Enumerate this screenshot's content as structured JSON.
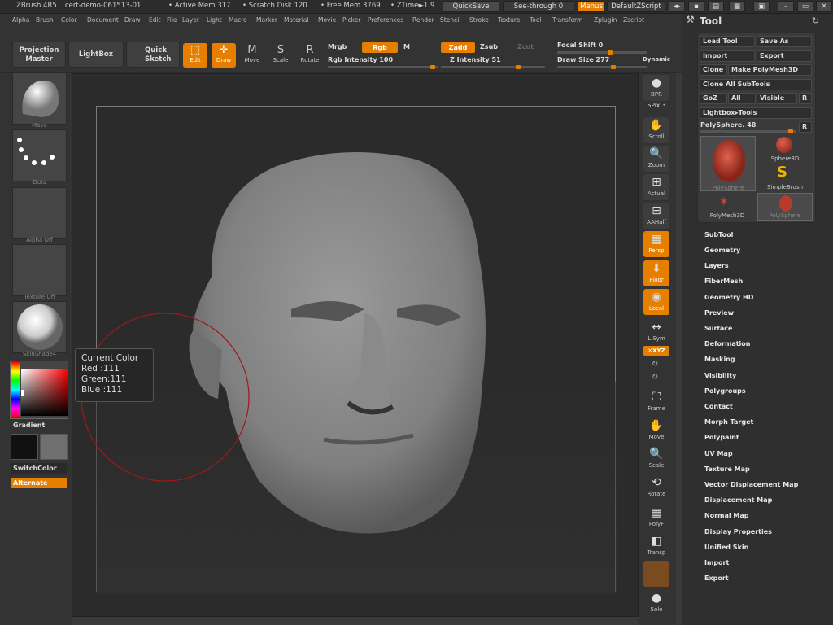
{
  "titlebar": {
    "app": "ZBrush 4R5",
    "doc": "cert-demo-061513-01",
    "active_mem": "• Active Mem 317",
    "scratch": "• Scratch Disk 120",
    "free_mem": "• Free Mem 3769",
    "ztime": "• ZTime►1.9",
    "quicksave": "QuickSave",
    "seethrough": "See-through  0",
    "menus": "Menus",
    "default_script": "DefaultZScript"
  },
  "menubar": {
    "items": [
      "Alpha",
      "Brush",
      "Color",
      "Document",
      "Draw",
      "Edit",
      "File",
      "Layer",
      "Light",
      "Macro",
      "Marker",
      "Material",
      "Movie",
      "Picker",
      "Preferences",
      "Render",
      "Stencil",
      "Stroke",
      "Texture",
      "Tool",
      "Transform",
      "Zplugin",
      "Zscript"
    ]
  },
  "toolbar": {
    "projection_master": "Projection Master",
    "lightbox": "LightBox",
    "quick_sketch": "Quick Sketch",
    "edit": "Edit",
    "draw": "Draw",
    "move": "Move",
    "scale": "Scale",
    "rotate": "Rotate",
    "mrgb": "Mrgb",
    "rgb": "Rgb",
    "m": "M",
    "rgb_intensity": "Rgb  Intensity 100",
    "zadd": "Zadd",
    "zsub": "Zsub",
    "zcut": "Zcut",
    "z_intensity": "Z  Intensity 51",
    "focal_shift": "Focal Shift 0",
    "draw_size": "Draw  Size 277",
    "dynamic": "Dynamic"
  },
  "left": {
    "brush_label": "Move",
    "stroke_label": "Dots",
    "alpha_label": "Alpha  Off",
    "texture_label": "Texture  Off",
    "material_label": "SkinShade4",
    "gradient": "Gradient",
    "switch_color": "SwitchColor",
    "alternate": "Alternate"
  },
  "color_tooltip": {
    "title": "Current Color",
    "red": "Red   :111",
    "green": "Green:111",
    "blue": "Blue :111"
  },
  "shelf": {
    "bpr": "BPR",
    "spix": "SPix 3",
    "scroll": "Scroll",
    "zoom": "Zoom",
    "actual": "Actual",
    "aahalf": "AAHalf",
    "persp": "Persp",
    "floor": "Floor",
    "local": "Local",
    "lsym": "L.Sym",
    "xyz": "✕XYZ",
    "frame": "Frame",
    "move": "Move",
    "scale": "Scale",
    "rotate": "Rotate",
    "polyf": "PolyF",
    "transp": "Transp",
    "solo": "Solo"
  },
  "tool": {
    "title": "Tool",
    "load_tool": "Load Tool",
    "save_as": "Save As",
    "import": "Import",
    "export": "Export",
    "clone": "Clone",
    "make_polymesh": "Make PolyMesh3D",
    "clone_all": "Clone All SubTools",
    "goz": "GoZ",
    "all": "All",
    "visible": "Visible",
    "r": "R",
    "lightbox_tools": "Lightbox▸Tools",
    "polysphere_slider": "PolySphere. 48",
    "items": [
      "PolySphere",
      "Sphere3D",
      "SimpleBrush",
      "PolyMesh3D",
      "PolySphere"
    ]
  },
  "submenus": [
    "SubTool",
    "Geometry",
    "Layers",
    "FiberMesh",
    "Geometry HD",
    "Preview",
    "Surface",
    "Deformation",
    "Masking",
    "Visibility",
    "Polygroups",
    "Contact",
    "Morph Target",
    "Polypaint",
    "UV Map",
    "Texture Map",
    "Vector Displacement Map",
    "Displacement Map",
    "Normal Map",
    "Display Properties",
    "Unified Skin",
    "Import",
    "Export"
  ],
  "colors": {
    "accent": "#e67e00",
    "panel": "#333333",
    "viewport": "#2b2b2b"
  }
}
